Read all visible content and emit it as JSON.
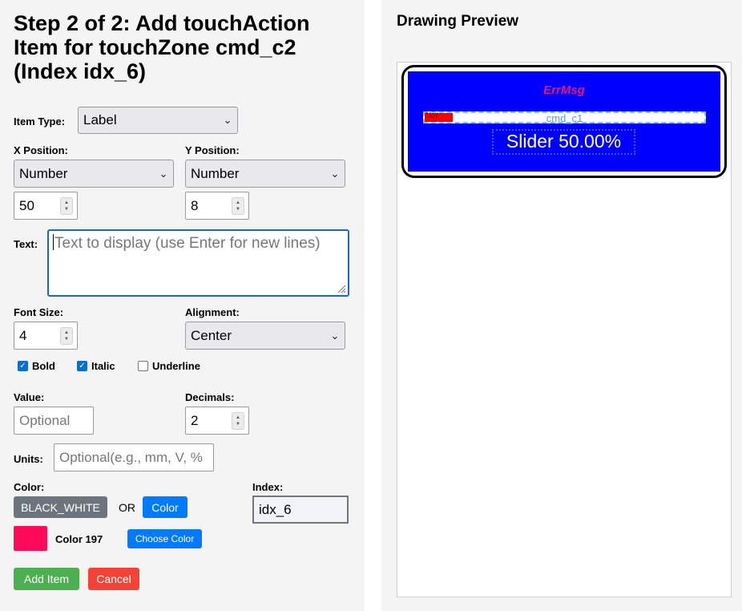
{
  "form": {
    "title": "Step 2 of 2: Add touchAction Item for touchZone cmd_c2 (Index idx_6)",
    "item_type": {
      "label": "Item Type:",
      "value": "Label"
    },
    "x_position": {
      "label": "X Position:",
      "mode": "Number",
      "value": "50"
    },
    "y_position": {
      "label": "Y Position:",
      "mode": "Number",
      "value": "8"
    },
    "text": {
      "label": "Text:",
      "placeholder": "Text to display (use Enter for new lines)"
    },
    "font_size": {
      "label": "Font Size:",
      "value": "4"
    },
    "alignment": {
      "label": "Alignment:",
      "value": "Center"
    },
    "checkboxes": [
      {
        "label": "Bold",
        "checked": true
      },
      {
        "label": "Italic",
        "checked": true
      },
      {
        "label": "Underline",
        "checked": false
      }
    ],
    "value_field": {
      "label": "Value:",
      "placeholder": "Optional"
    },
    "decimals": {
      "label": "Decimals:",
      "value": "2"
    },
    "units": {
      "label": "Units:",
      "placeholder": "Optional(e.g., mm, V, %"
    },
    "color": {
      "label": "Color:",
      "preset_button": "BLACK_WHITE",
      "or_text": "OR",
      "color_button": "Color",
      "swatch_hex": "#ff0a5a",
      "selected_name": "Color 197",
      "choose_button": "Choose Color"
    },
    "index": {
      "label": "Index:",
      "value": "idx_6"
    },
    "add_button": "Add Item",
    "cancel_button": "Cancel"
  },
  "preview": {
    "heading": "Drawing Preview",
    "errmsg": "ErrMsg",
    "cmd_label": "cmd_c1",
    "red_tag": "Not",
    "slider_text": "Slider 50.00%",
    "screen_color": "#0000ff",
    "errmsg_color": "#e0167a",
    "slider_fill_pct": 10
  },
  "colors": {
    "panel_bg": "#f4f4f4",
    "primary_blue": "#007bff",
    "grey_button": "#6c757d",
    "add_green": "#4caf50",
    "cancel_red": "#f44336"
  }
}
